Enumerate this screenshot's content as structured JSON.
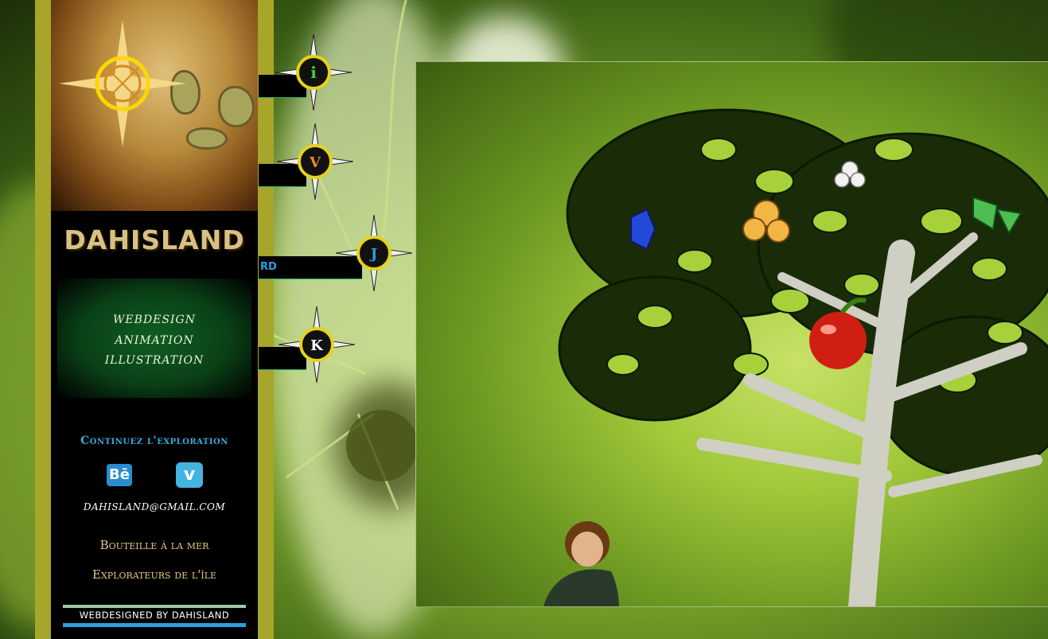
{
  "site": {
    "title": "DAHISLAND",
    "skills": [
      "WEBDESIGN",
      "ANIMATION",
      "ILLUSTRATION"
    ],
    "explore_heading": "Continuez l'exploration",
    "social": {
      "behance_label": "Bē",
      "vimeo_label": "v"
    },
    "email": "DAHISLAND@GMAIL.COM",
    "links": [
      "Bouteille à la mer",
      "Explorateurs de l'île"
    ],
    "credit": "WEBDESIGNED BY DAHISLAND"
  },
  "compass_menu": [
    {
      "letter": "i",
      "color": "#3ed13e"
    },
    {
      "letter": "V",
      "color": "#e9872a"
    },
    {
      "letter": "J",
      "color": "#2a9fe0",
      "tab_text": "RD"
    },
    {
      "letter": "K",
      "color": "#ffffff"
    }
  ]
}
